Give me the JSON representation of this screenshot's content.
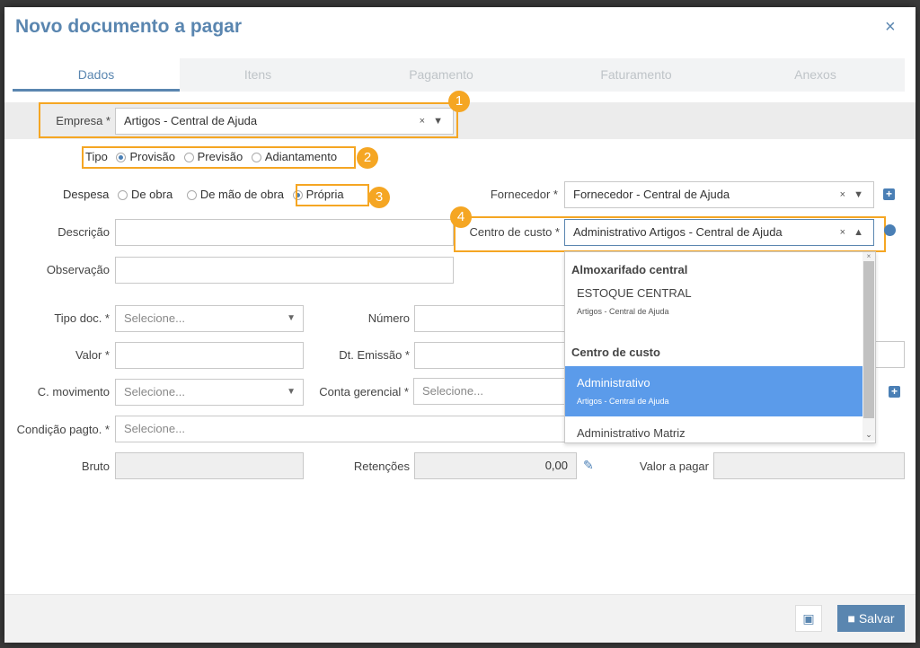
{
  "dialog": {
    "title": "Novo documento a pagar",
    "close": "×"
  },
  "tabs": [
    {
      "label": "Dados",
      "active": true
    },
    {
      "label": "Itens"
    },
    {
      "label": "Pagamento"
    },
    {
      "label": "Faturamento"
    },
    {
      "label": "Anexos"
    }
  ],
  "form": {
    "empresa": {
      "label": "Empresa *",
      "value": "Artigos - Central de Ajuda"
    },
    "tipo": {
      "label": "Tipo",
      "options": [
        "Provisão",
        "Previsão",
        "Adiantamento"
      ],
      "selected": "Provisão"
    },
    "despesa": {
      "label": "Despesa",
      "options": [
        "De obra",
        "De mão de obra",
        "Própria"
      ],
      "selected": "Própria"
    },
    "fornecedor": {
      "label": "Fornecedor *",
      "value": "Fornecedor - Central de Ajuda"
    },
    "descricao": {
      "label": "Descrição",
      "value": ""
    },
    "centro_custo": {
      "label": "Centro de custo *",
      "value": "Administrativo Artigos - Central de Ajuda"
    },
    "observacao": {
      "label": "Observação",
      "value": ""
    },
    "tipo_doc": {
      "label": "Tipo doc. *",
      "placeholder": "Selecione..."
    },
    "numero": {
      "label": "Número",
      "value": ""
    },
    "valor": {
      "label": "Valor *",
      "value": ""
    },
    "dt_emissao": {
      "label": "Dt. Emissão *",
      "value": ""
    },
    "c_movimento": {
      "label": "C. movimento",
      "placeholder": "Selecione..."
    },
    "conta_gerencial": {
      "label": "Conta gerencial *",
      "placeholder": "Selecione..."
    },
    "condicao_pagto": {
      "label": "Condição pagto. *",
      "placeholder": "Selecione..."
    },
    "bruto": {
      "label": "Bruto",
      "value": ""
    },
    "retencoes": {
      "label": "Retenções",
      "value": "0,00"
    },
    "valor_pagar": {
      "label": "Valor a pagar",
      "value": ""
    }
  },
  "dropdown": {
    "groups": [
      {
        "name": "Almoxarifado central"
      },
      {
        "name": "Centro de custo"
      }
    ],
    "options": [
      {
        "label": "ESTOQUE CENTRAL",
        "sub": "Artigos - Central de Ajuda"
      },
      {
        "label": "Administrativo",
        "sub": "Artigos - Central de Ajuda",
        "selected": true
      },
      {
        "label": "Administrativo Matriz"
      }
    ]
  },
  "badges": [
    "1",
    "2",
    "3",
    "4"
  ],
  "footer": {
    "save_label": "Salvar"
  },
  "colors": {
    "accent": "#5a86b0",
    "highlight": "#f5a623",
    "selected_option": "#5b9bea"
  }
}
